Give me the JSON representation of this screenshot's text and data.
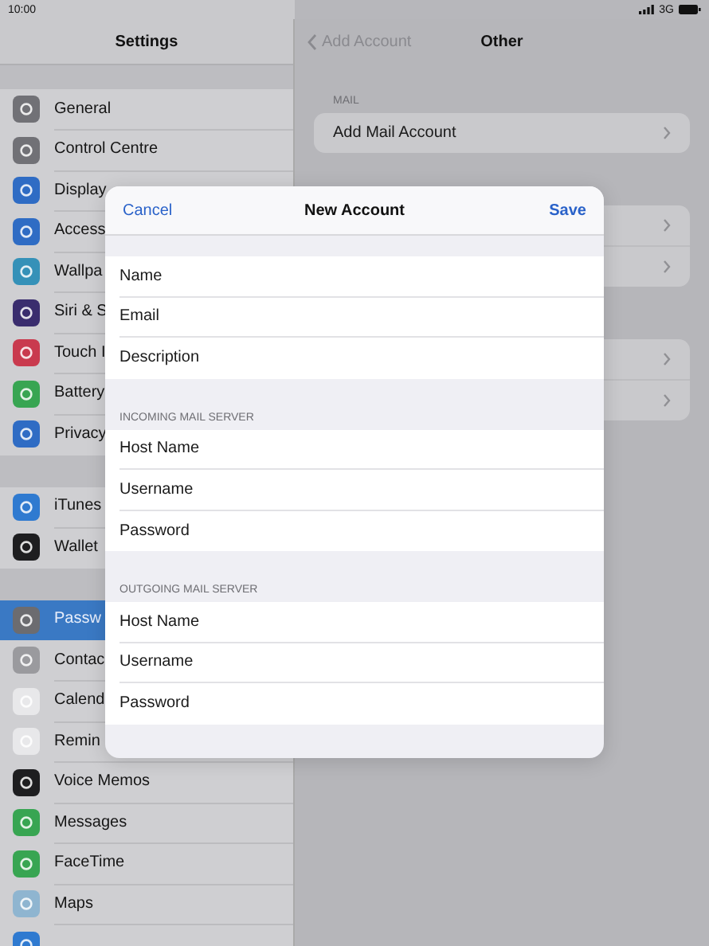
{
  "status_bar": {
    "time": "10:00",
    "network": "3G"
  },
  "sidebar": {
    "title": "Settings",
    "groups": [
      [
        {
          "label": "General",
          "color": "#717176",
          "selected": false
        },
        {
          "label": "Control Centre",
          "color": "#717176",
          "selected": false
        },
        {
          "label": "Display",
          "color": "#2f6cc4",
          "selected": false
        },
        {
          "label": "Access",
          "color": "#2f6cc4",
          "selected": false
        },
        {
          "label": "Wallpa",
          "color": "#3591b8",
          "selected": false
        },
        {
          "label": "Siri & S",
          "color": "#3a2d6e",
          "selected": false
        },
        {
          "label": "Touch I",
          "color": "#c93a4e",
          "selected": false
        },
        {
          "label": "Battery",
          "color": "#38a552",
          "selected": false
        },
        {
          "label": "Privacy",
          "color": "#2f6cc4",
          "selected": false
        }
      ],
      [
        {
          "label": "iTunes",
          "color": "#2f7ad0",
          "selected": false
        },
        {
          "label": "Wallet",
          "color": "#1e1e20",
          "selected": false
        }
      ],
      [
        {
          "label": "Passw",
          "color": "#6c6c70",
          "selected": true
        },
        {
          "label": "Contac",
          "color": "#9a9a9e",
          "selected": false
        },
        {
          "label": "Calend",
          "color": "#e8e8ea",
          "selected": false
        },
        {
          "label": "Remin",
          "color": "#e8e8ea",
          "selected": false
        },
        {
          "label": "Voice Memos",
          "color": "#1e1e20",
          "selected": false
        },
        {
          "label": "Messages",
          "color": "#38a552",
          "selected": false
        },
        {
          "label": "FaceTime",
          "color": "#38a552",
          "selected": false
        },
        {
          "label": "Maps",
          "color": "#8fb5d0",
          "selected": false
        },
        {
          "color": "#2f7ad0",
          "selected": false
        }
      ]
    ]
  },
  "detail": {
    "back": "Add Account",
    "title": "Other",
    "section": "MAIL",
    "row": "Add Mail Account",
    "hidden_groups": [
      [
        {
          "kind": "row"
        },
        {
          "kind": "row"
        }
      ],
      [
        {
          "kind": "row"
        },
        {
          "kind": "row"
        }
      ]
    ]
  },
  "sheet": {
    "cancel": "Cancel",
    "title": "New Account",
    "save": "Save",
    "sections": [
      {
        "fields": [
          {
            "label": "Name"
          },
          {
            "label": "Email"
          },
          {
            "label": "Description"
          }
        ]
      },
      {
        "header": "INCOMING MAIL SERVER",
        "fields": [
          {
            "label": "Host Name"
          },
          {
            "label": "Username"
          },
          {
            "label": "Password"
          }
        ]
      },
      {
        "header": "OUTGOING MAIL SERVER",
        "fields": [
          {
            "label": "Host Name"
          },
          {
            "label": "Username"
          },
          {
            "label": "Password"
          }
        ]
      }
    ]
  }
}
